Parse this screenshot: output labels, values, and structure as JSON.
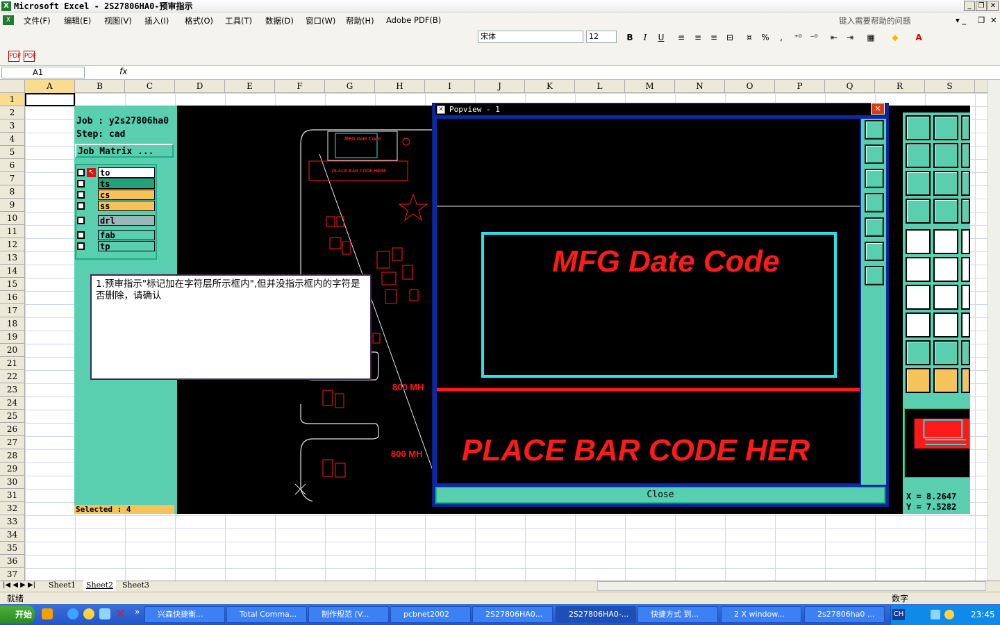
{
  "window": {
    "title": "Microsoft Excel - 2S27806HA0-预审指示",
    "app_icon": "excel-icon"
  },
  "menu": {
    "items": [
      "文件(F)",
      "编辑(E)",
      "视图(V)",
      "插入(I)",
      "格式(O)",
      "工具(T)",
      "数据(D)",
      "窗口(W)",
      "帮助(H)",
      "Adobe PDF(B)"
    ],
    "help_placeholder": "键入需要帮助的问题"
  },
  "format_toolbar": {
    "font": "宋体",
    "size": "12",
    "bold": "B",
    "italic": "I",
    "underline": "U",
    "percent": "%",
    "comma": ","
  },
  "formula_bar": {
    "cell_ref": "A1",
    "fx": "fx",
    "value": ""
  },
  "grid": {
    "columns": [
      "A",
      "B",
      "C",
      "D",
      "E",
      "F",
      "G",
      "H",
      "I",
      "J",
      "K",
      "L",
      "M",
      "N",
      "O",
      "P",
      "Q",
      "R",
      "S"
    ],
    "rows": [
      "1",
      "2",
      "3",
      "4",
      "5",
      "6",
      "7",
      "8",
      "9",
      "10",
      "11",
      "12",
      "13",
      "14",
      "15",
      "16",
      "17",
      "18",
      "19",
      "20",
      "21",
      "22",
      "23",
      "24",
      "25",
      "26",
      "27",
      "28",
      "29",
      "30",
      "31",
      "32",
      "33",
      "34",
      "35",
      "36",
      "37"
    ]
  },
  "sheets": [
    "Sheet1",
    "Sheet2",
    "Sheet3"
  ],
  "active_sheet": "Sheet2",
  "status": {
    "left": "就绪",
    "mode": "数字"
  },
  "embedded_app": {
    "job": "Job : y2s27806ha0",
    "step": "Step: cad",
    "job_matrix": "Job Matrix ...",
    "layers": [
      {
        "name": "to",
        "color": "#ffffff"
      },
      {
        "name": "ts",
        "color": "#1fa37a"
      },
      {
        "name": "cs",
        "color": "#f6c35a"
      },
      {
        "name": "ss",
        "color": "#f6c35a"
      },
      {
        "name": "drl",
        "color": "#9ab8b8"
      },
      {
        "name": "fab",
        "color": "#59cfb0"
      },
      {
        "name": "tp",
        "color": "#59cfb0"
      }
    ],
    "selected": "Selected : 4",
    "pcb_labels": {
      "mfg_small": "MFG Date Code",
      "barcode_small": "PLACE BAR CODE HERE",
      "freq1": "800 MH",
      "freq2": "800 MH"
    },
    "coords": {
      "x": "X = 8.2647",
      "y": "Y = 7.5282"
    }
  },
  "comment": {
    "text": "1.预审指示\"标记加在字符层所示框内\",但并没指示框内的字符是否删除，请确认"
  },
  "popview": {
    "title": "Popview - 1",
    "mfg_text": "MFG Date Code",
    "barcode_text": "PLACE BAR CODE HER",
    "close_label": "Close"
  },
  "taskbar": {
    "start": "开始",
    "tasks": [
      "兴森快捷衡...",
      "Total Comma...",
      "制作规范 (V...",
      "pcbnet2002",
      "2S27806HA0...",
      "2S27806HA0-...",
      "快捷方式 到...",
      "2 X window...",
      "2s27806ha0 ..."
    ],
    "active_task": 5,
    "tray_lang": "CH",
    "time": "23:45"
  },
  "colors": {
    "panel": "#59cfb0",
    "pcb_red": "#ff1a1a",
    "popview_frame": "#0a2aa8",
    "box_cyan": "#27e3ea"
  }
}
